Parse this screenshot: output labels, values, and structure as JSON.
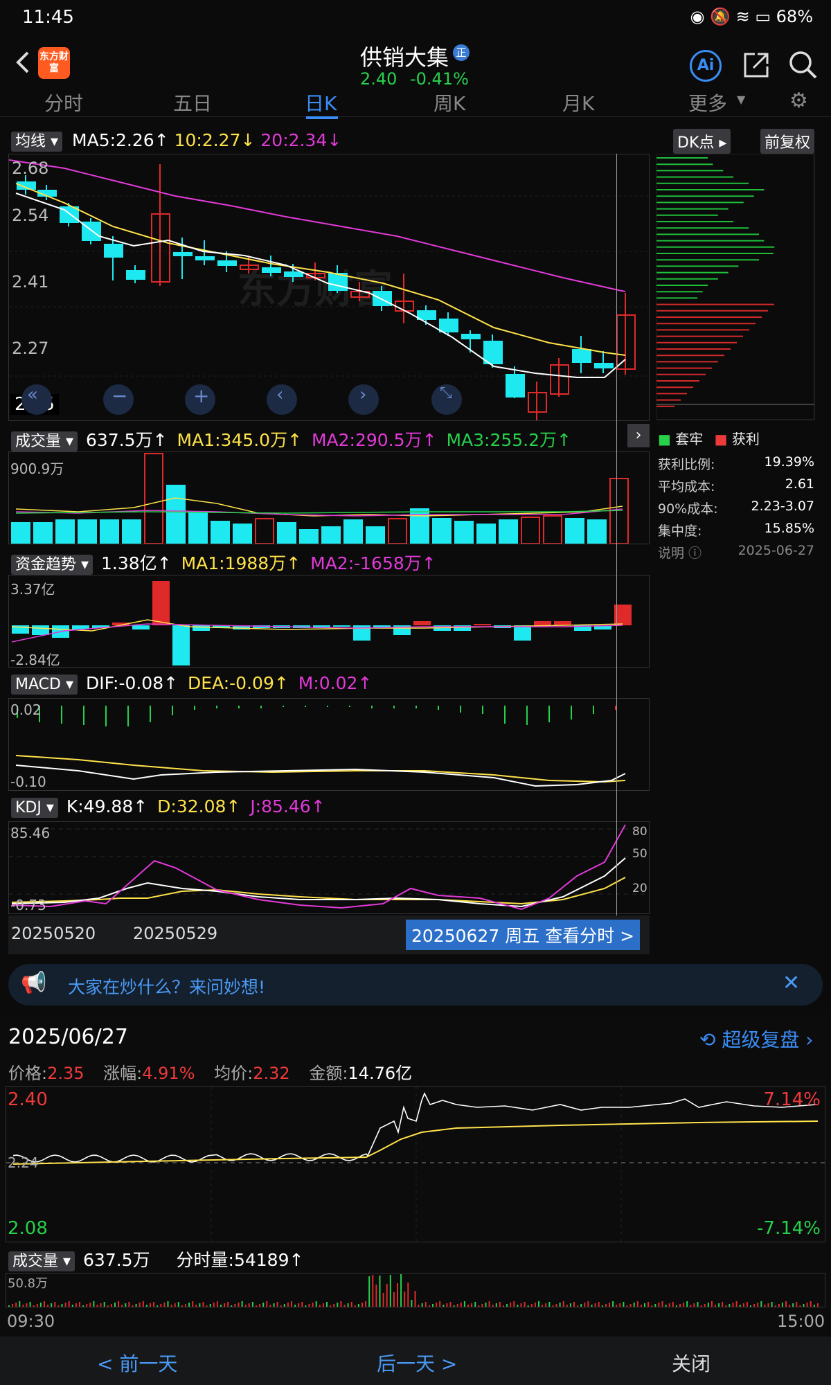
{
  "status_bar": {
    "time": "11:45",
    "battery": "68%"
  },
  "header": {
    "logo_text": "东方财富",
    "title": "供销大集",
    "badge": "正",
    "price": "2.40",
    "change_pct": "-0.41%",
    "ai_label": "Ai"
  },
  "tabs": [
    {
      "label": "分时"
    },
    {
      "label": "五日"
    },
    {
      "label": "日K"
    },
    {
      "label": "周K"
    },
    {
      "label": "月K"
    },
    {
      "label": "更多"
    }
  ],
  "kline": {
    "selector": "均线",
    "ma5": "MA5:2.26",
    "ma10": "10:2.27",
    "ma20": "20:2.34",
    "dk_button": "DK点",
    "adjust_button": "前复权",
    "y_labels": [
      "2.68",
      "2.54",
      "2.41",
      "2.27",
      "2.15"
    ],
    "watermark": "东方财富"
  },
  "volume": {
    "selector": "成交量",
    "value": "637.5万",
    "ma1": "MA1:345.0万",
    "ma2": "MA2:290.5万",
    "ma3": "MA3:255.2万",
    "max_label": "900.9万"
  },
  "chip": {
    "legend_trapped": "套牢",
    "legend_profit": "获利",
    "rows": [
      {
        "label": "获利比例:",
        "value": "19.39%"
      },
      {
        "label": "平均成本:",
        "value": "2.61"
      },
      {
        "label": "90%成本:",
        "value": "2.23-3.07"
      },
      {
        "label": "集中度:",
        "value": "15.85%"
      }
    ],
    "note_label": "说明",
    "date": "2025-06-27"
  },
  "fund": {
    "selector": "资金趋势",
    "value": "1.38亿",
    "ma1": "MA1:1988万",
    "ma2": "MA2:-1658万",
    "top_label": "3.37亿",
    "bottom_label": "-2.84亿"
  },
  "macd": {
    "selector": "MACD",
    "dif": "DIF:-0.08",
    "dea": "DEA:-0.09",
    "m": "M:0.02",
    "top_label": "0.02",
    "bottom_label": "-0.10"
  },
  "kdj": {
    "selector": "KDJ",
    "k": "K:49.88",
    "d": "D:32.08",
    "j": "J:85.46",
    "top_label": "85.46",
    "bottom_label": "-0.73",
    "right_labels": [
      "80",
      "50",
      "20"
    ]
  },
  "dates": {
    "d1": "20250520",
    "d2": "20250529",
    "cursor": "20250627 周五 查看分时 >"
  },
  "banner": {
    "text": "大家在炒什么？来问妙想!"
  },
  "intraday": {
    "date": "2025/06/27",
    "replay": "超级复盘",
    "price_label": "价格:",
    "price": "2.35",
    "chg_label": "涨幅:",
    "chg": "4.91%",
    "avg_label": "均价:",
    "avg": "2.32",
    "amount_label": "金额:",
    "amount": "14.76亿",
    "top_left": "2.40",
    "mid_left": "2.24",
    "bottom_left": "2.08",
    "top_right": "7.14%",
    "bottom_right": "-7.14%",
    "vol_selector": "成交量",
    "vol_value": "637.5万",
    "tick_vol": "分时量:54189",
    "vol_max": "50.8万",
    "t_start": "09:30",
    "t_end": "15:00"
  },
  "bottom_nav": {
    "prev": "< 前一天",
    "next": "后一天 >",
    "close": "关闭"
  }
}
